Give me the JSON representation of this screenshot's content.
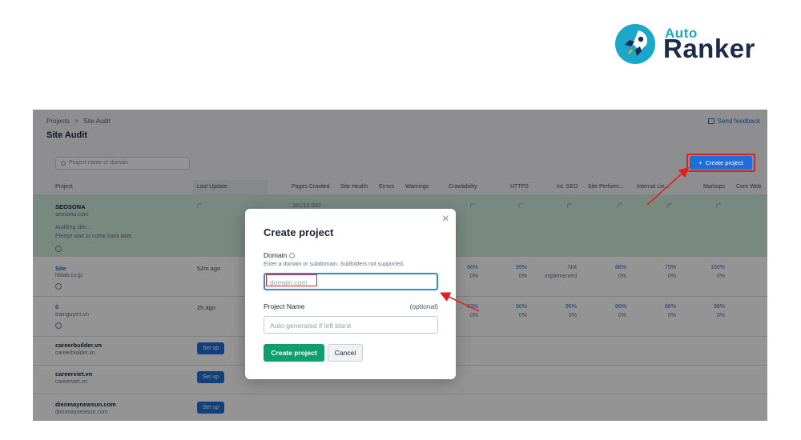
{
  "logo": {
    "top_word": "Auto",
    "main_word": "Ranker"
  },
  "breadcrumb": {
    "root": "Projects",
    "separator": ">",
    "current": "Site Audit"
  },
  "page_title": "Site Audit",
  "feedback_label": "Send feedback",
  "search": {
    "placeholder": "Project name or domain"
  },
  "create_button": {
    "icon": "+",
    "label": "Create project"
  },
  "table": {
    "columns": [
      "Project",
      "Last Update",
      "Pages Crawled",
      "Site Health",
      "Errors",
      "Warnings",
      "Crawlability",
      "HTTPS",
      "Int. SEO",
      "Site Perform...",
      "Internal Lin...",
      "Markups",
      "Core Web"
    ],
    "rows": [
      {
        "name": "SEOSONA",
        "domain": "seosona.com",
        "status_line1": "Auditing site...",
        "status_line2": "Please wait or come back later.",
        "pages": "181/10 000"
      },
      {
        "name": "Site",
        "domain": "hblab.co.jp",
        "time": "52m ago",
        "crawl": [
          "86%",
          "0%"
        ],
        "https": [
          "99%",
          "0%"
        ],
        "intseo": [
          "Not",
          "implemented"
        ],
        "perf": [
          "88%",
          "0%"
        ],
        "links": [
          "75%",
          "0%"
        ],
        "markups": [
          "100%",
          "0%"
        ]
      },
      {
        "name": "0",
        "domain": "trainguyen.vn",
        "time": "2h ago",
        "crawl": [
          "83%",
          "0%"
        ],
        "https": [
          "90%",
          "0%"
        ],
        "intseo": [
          "95%",
          "0%"
        ],
        "perf": [
          "86%",
          "0%"
        ],
        "links": [
          "86%",
          "0%"
        ],
        "markups": [
          "99%",
          "0%"
        ]
      },
      {
        "name": "careerbuilder.vn",
        "domain": "careerbuilder.vn",
        "action": "Set up"
      },
      {
        "name": "careerviet.vn",
        "domain": "careerviet.vn",
        "action": "Set up"
      },
      {
        "name": "dienmaynewsun.com",
        "domain": "dienmaynewsun.com",
        "action": "Set up"
      }
    ]
  },
  "modal": {
    "title": "Create project",
    "close_glyph": "×",
    "domain_label": "Domain",
    "domain_hint": "Enter a domain or subdomain. Subfolders not supported.",
    "domain_placeholder": "domain.com",
    "name_label": "Project Name",
    "name_optional": "(optional)",
    "name_placeholder": "Auto-generated if left blank",
    "create_label": "Create project",
    "cancel_label": "Cancel"
  },
  "colors": {
    "accent": "#1e6fd9",
    "confirm": "#0f9f6e",
    "highlight": "#e02020",
    "auditing_row": "#cfeedd"
  }
}
